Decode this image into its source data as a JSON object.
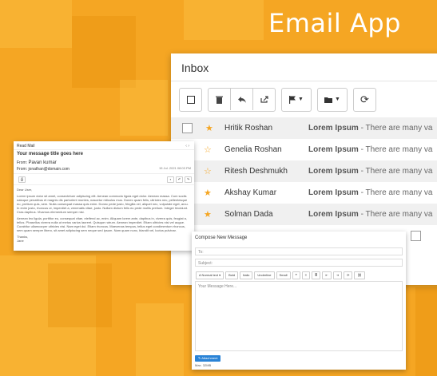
{
  "hero": {
    "title": "Email App"
  },
  "inbox": {
    "title": "Inbox",
    "rows": [
      {
        "sender": "Hritik Roshan",
        "starred": true,
        "subject": "Lorem Ipsum",
        "snippet": " - There are many va"
      },
      {
        "sender": "Genelia Roshan",
        "starred": false,
        "subject": "Lorem Ipsum",
        "snippet": " - There are many va"
      },
      {
        "sender": "Ritesh Deshmukh",
        "starred": false,
        "subject": "Lorem Ipsum",
        "snippet": " - There are many va"
      },
      {
        "sender": "Akshay Kumar",
        "starred": true,
        "subject": "Lorem Ipsum",
        "snippet": " - There are many va"
      },
      {
        "sender": "Solman Dada",
        "starred": true,
        "subject": "Lorem Ipsum",
        "snippet": " - There are many va"
      }
    ]
  },
  "read_mail": {
    "header": "Read Mail",
    "nav": "‹  ›",
    "subject": "Your message title goes here",
    "from_label": "From:",
    "from_name": "Pavan kumar",
    "from_line": "From: jonathan@domain.com",
    "date": "15 Jul. 2021 08:03 PM",
    "greeting": "Dear User,",
    "para1": "Lorem ipsum dolor sit amet, consectetuer adipiscing elit. Aenean commodo ligula eget dolor. Aenean massa. Cum sociis natoque penatibus et magnis dis parturient montes, nascetur ridiculus mus. Donec quam felis, ultricies nec, pellentesque eu, pretium quis, sem. Nulla consequat massa quis enim. Donec pede justo, fringilla vel, aliquet nec, vulputate eget, arcu. In enim justo, rhoncus ut, imperdiet a, venenatis vitae, justo. Nullam dictum felis eu pede mollis pretium. Integer tincidunt. Cras dapibus. Vivamus elementum semper nisi.",
    "para2": "Aenean leo ligula, porttitor eu, consequat vitae, eleifend ac, enim. Aliquam lorem ante, dapibus in, viverra quis, feugiat a, tellus. Phasellus viverra nulla ut metus varius laoreet. Quisque rutrum. Aenean imperdiet. Etiam ultricies nisi vel augue. Curabitur ullamcorper ultricies nisi. Nam eget dui. Etiam rhoncus. Maecenas tempus, tellus eget condimentum rhoncus, sem quam semper libero, sit amet adipiscing sem neque sed ipsum. Nam quam nunc, blandit vel, luctus pulvinar.",
    "thanks": "Thanks,",
    "signature": "Jane"
  },
  "compose": {
    "title": "Compose New Message",
    "to_placeholder": "To:",
    "subject_placeholder": "Subject:",
    "tools": [
      "A Normal text ▾",
      "Bold",
      "Italic",
      "Underline",
      "Small",
      "❝",
      "≡",
      "≣",
      "⇤",
      "⇥",
      "⟳",
      "⛓"
    ],
    "body_placeholder": "Your Message Here...",
    "attach_label": "✎ Attachment",
    "max_size": "Max. 32MB"
  }
}
